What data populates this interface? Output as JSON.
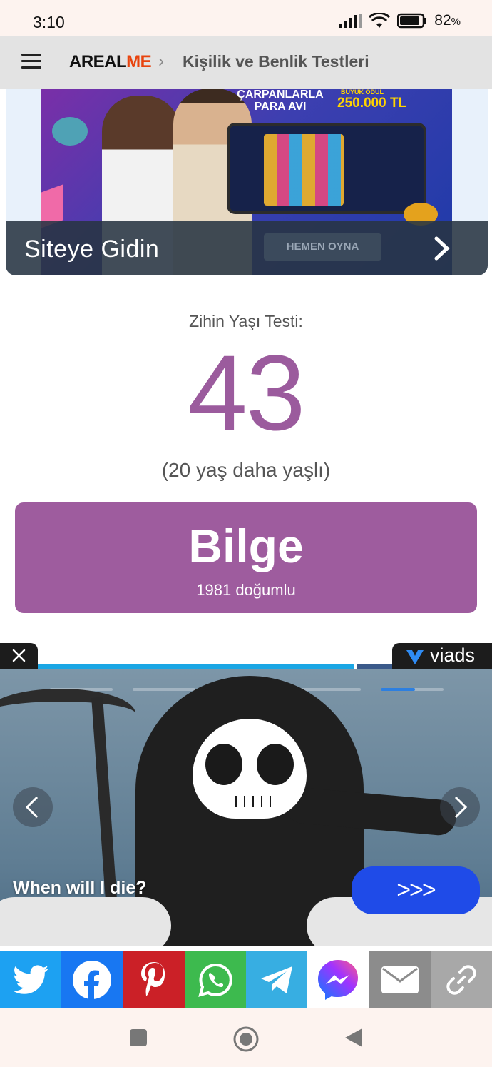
{
  "status_bar": {
    "time": "3:10",
    "battery": "82",
    "battery_unit": "%"
  },
  "header": {
    "logo_a": "AREAL",
    "logo_b": "ME",
    "breadcrumb_sep": "›",
    "breadcrumb": "Kişilik ve Benlik Testleri"
  },
  "ad_top": {
    "headline_1": "ÇARPANLARLA",
    "headline_2": "PARA AVI",
    "prize_label": "BÜYÜK ÖDÜL",
    "prize": "250.000 TL",
    "visit_label": "Siteye Gidin",
    "play_button": "HEMEN OYNA"
  },
  "result": {
    "label": "Zihin Yaşı Testi:",
    "age": "43",
    "difference": "(20 yaş daha yaşlı)",
    "title": "Bilge",
    "subtitle": "1981 doğumlu"
  },
  "ad_video": {
    "brand": "viads",
    "question": "When will I die?",
    "cta": ">>>",
    "slides_total": 5,
    "active_slide": 5,
    "active_slide_progress": 0.55
  },
  "share": {
    "items": [
      {
        "name": "twitter",
        "color": "#1da1f2"
      },
      {
        "name": "facebook",
        "color": "#1877f2"
      },
      {
        "name": "pinterest",
        "color": "#cb2027"
      },
      {
        "name": "whatsapp",
        "color": "#3dba4e"
      },
      {
        "name": "telegram",
        "color": "#37aee2"
      },
      {
        "name": "messenger",
        "color": "#ffffff"
      },
      {
        "name": "email",
        "color": "#8c8c8c"
      },
      {
        "name": "link",
        "color": "#a8a8a8"
      }
    ]
  },
  "colors": {
    "accent": "#9e5c9e",
    "brand": "#e8440f",
    "cta": "#1f4be8"
  }
}
